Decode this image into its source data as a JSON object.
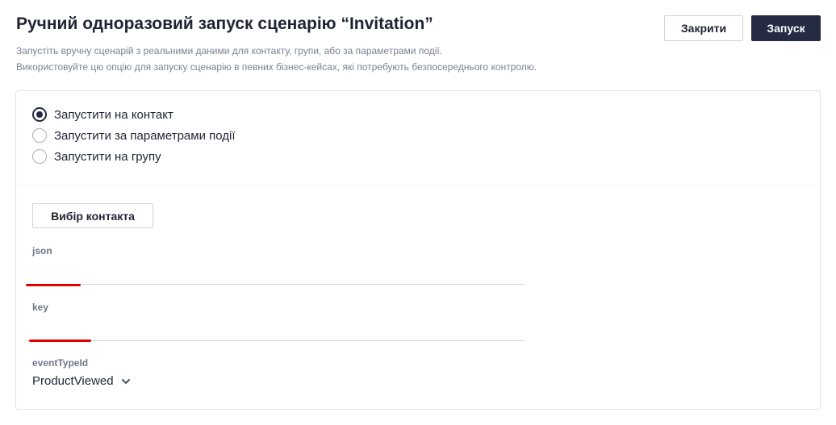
{
  "header": {
    "title": "Ручний одноразовий запуск сценарію “Invitation”",
    "description_line1": "Запустіть вручну сценарій з реальними даними для контакту, групи, або за параметрами події.",
    "description_line2": "Використовуйте цю опцію для запуску сценарію в певних бізнес-кейсах, які потребують безпосереднього контролю.",
    "close_label": "Закрити",
    "run_label": "Запуск"
  },
  "run_mode": {
    "options": [
      {
        "label": "Запустити на контакт",
        "checked": true
      },
      {
        "label": "Запустити за параметрами події",
        "checked": false
      },
      {
        "label": "Запустити на групу",
        "checked": false
      }
    ]
  },
  "form": {
    "choose_contact_label": "Вибір контакта",
    "json_label": "json",
    "json_value": "",
    "key_label": "key",
    "key_value": "",
    "event_type_label": "eventTypeId",
    "event_type_value": "ProductViewed"
  },
  "colors": {
    "primary": "#242b42",
    "annotation_red": "#e00000",
    "muted_text": "#7a8194"
  }
}
